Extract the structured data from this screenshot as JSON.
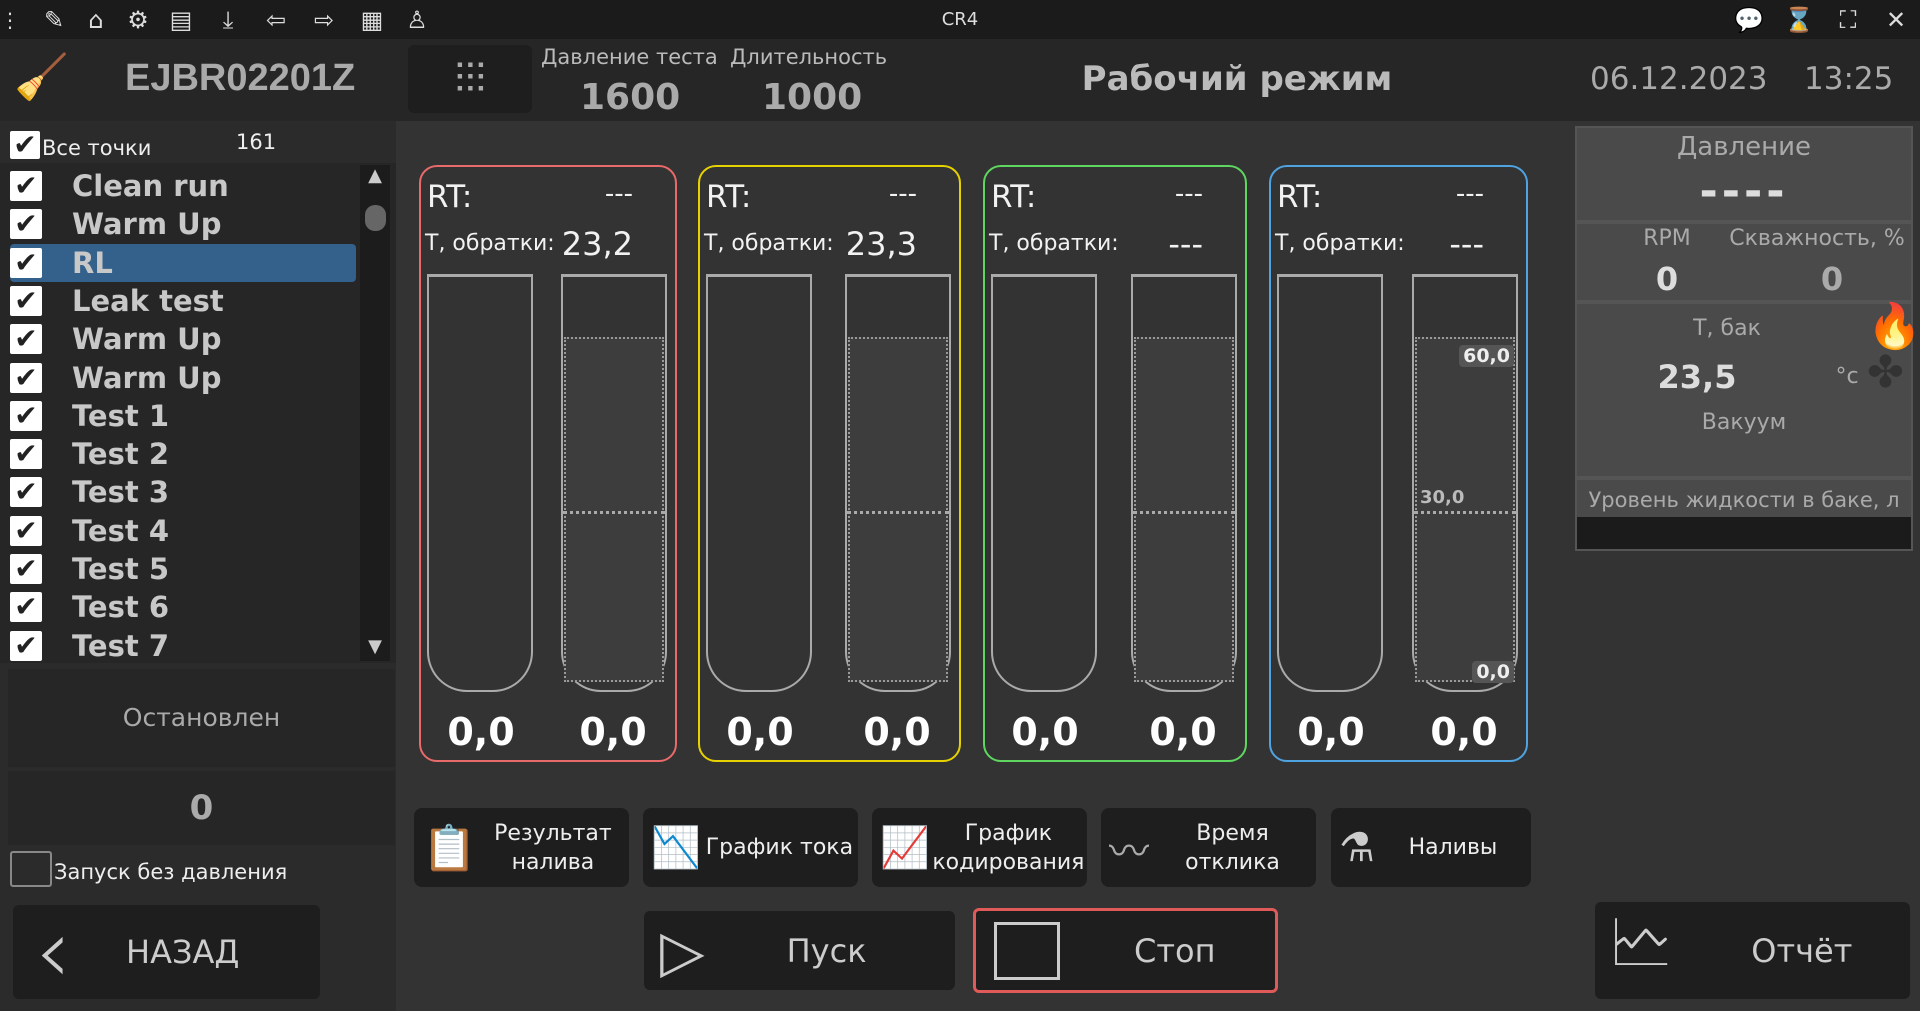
{
  "topbar": {
    "title": "CR4",
    "icons": [
      "menu-dots-icon",
      "pencil-icon",
      "home-icon",
      "gear-icon",
      "toolbox-icon",
      "download-icon",
      "import-icon",
      "export-icon",
      "clipboard-icon",
      "worker-icon"
    ],
    "right_icons": [
      "chat-icon",
      "hourglass-icon",
      "fullscreen-icon",
      "close-icon"
    ]
  },
  "header": {
    "serial": "EJBR02201Z",
    "pressure_label": "Давление теста",
    "pressure_value": "1600",
    "duration_label": "Длительность",
    "duration_value": "1000",
    "mode": "Рабочий режим",
    "date": "06.12.2023",
    "time": "13:25"
  },
  "left": {
    "all_points_label": "Все точки",
    "all_points_checked": true,
    "count": "161",
    "items": [
      {
        "label": "Clean run",
        "checked": true
      },
      {
        "label": "Warm Up",
        "checked": true
      },
      {
        "label": "RL",
        "checked": true,
        "selected": true
      },
      {
        "label": "Leak test",
        "checked": true
      },
      {
        "label": "Warm Up",
        "checked": true
      },
      {
        "label": "Warm Up",
        "checked": true
      },
      {
        "label": "Test 1",
        "checked": true
      },
      {
        "label": "Test 2",
        "checked": true
      },
      {
        "label": "Test 3",
        "checked": true
      },
      {
        "label": "Test 4",
        "checked": true
      },
      {
        "label": "Test 5",
        "checked": true
      },
      {
        "label": "Test 6",
        "checked": true
      },
      {
        "label": "Test 7",
        "checked": true
      }
    ],
    "status": "Остановлен",
    "counter": "0",
    "no_pressure_label": "Запуск без давления",
    "no_pressure_checked": false,
    "back_label": "НАЗАД"
  },
  "channels": [
    {
      "color": "#e86a6a",
      "rt_label": "RT:",
      "rt_value": "---",
      "t_label": "Т, обратки:",
      "t_value": "23,2",
      "left_value": "0,0",
      "right_value": "0,0"
    },
    {
      "color": "#e6d200",
      "rt_label": "RT:",
      "rt_value": "---",
      "t_label": "Т, обратки:",
      "t_value": "23,3",
      "left_value": "0,0",
      "right_value": "0,0"
    },
    {
      "color": "#5fd65f",
      "rt_label": "RT:",
      "rt_value": "---",
      "t_label": "Т, обратки:",
      "t_value": "---",
      "left_value": "0,0",
      "right_value": "0,0"
    },
    {
      "color": "#4fa3e0",
      "rt_label": "RT:",
      "rt_value": "---",
      "t_label": "Т, обратки:",
      "t_value": "---",
      "left_value": "0,0",
      "right_value": "0,0",
      "scale": [
        "60,0",
        "30,0",
        "0,0"
      ]
    }
  ],
  "functions": [
    {
      "label": "Результат\nналива",
      "icon": "checklist-icon"
    },
    {
      "label": "График тока",
      "icon": "current-chart-icon"
    },
    {
      "label": "График\nкодирования",
      "icon": "coding-chart-icon"
    },
    {
      "label": "Время\nотклика",
      "icon": "response-time-icon"
    },
    {
      "label": "Наливы",
      "icon": "flask-icon"
    }
  ],
  "controls": {
    "start_label": "Пуск",
    "stop_label": "Стоп",
    "report_label": "Отчёт",
    "stop_border": "#e05a5a"
  },
  "right": {
    "pressure_label": "Давление",
    "pressure_value": "----",
    "rpm_label": "RPM",
    "rpm_value": "0",
    "duty_label": "Скважность, %",
    "duty_value": "0",
    "tank_t_label": "Т, бак",
    "tank_t_value": "23,5",
    "tank_t_unit": "°c",
    "vacuum_label": "Вакуум",
    "level_label": "Уровень жидкости в баке, л"
  }
}
